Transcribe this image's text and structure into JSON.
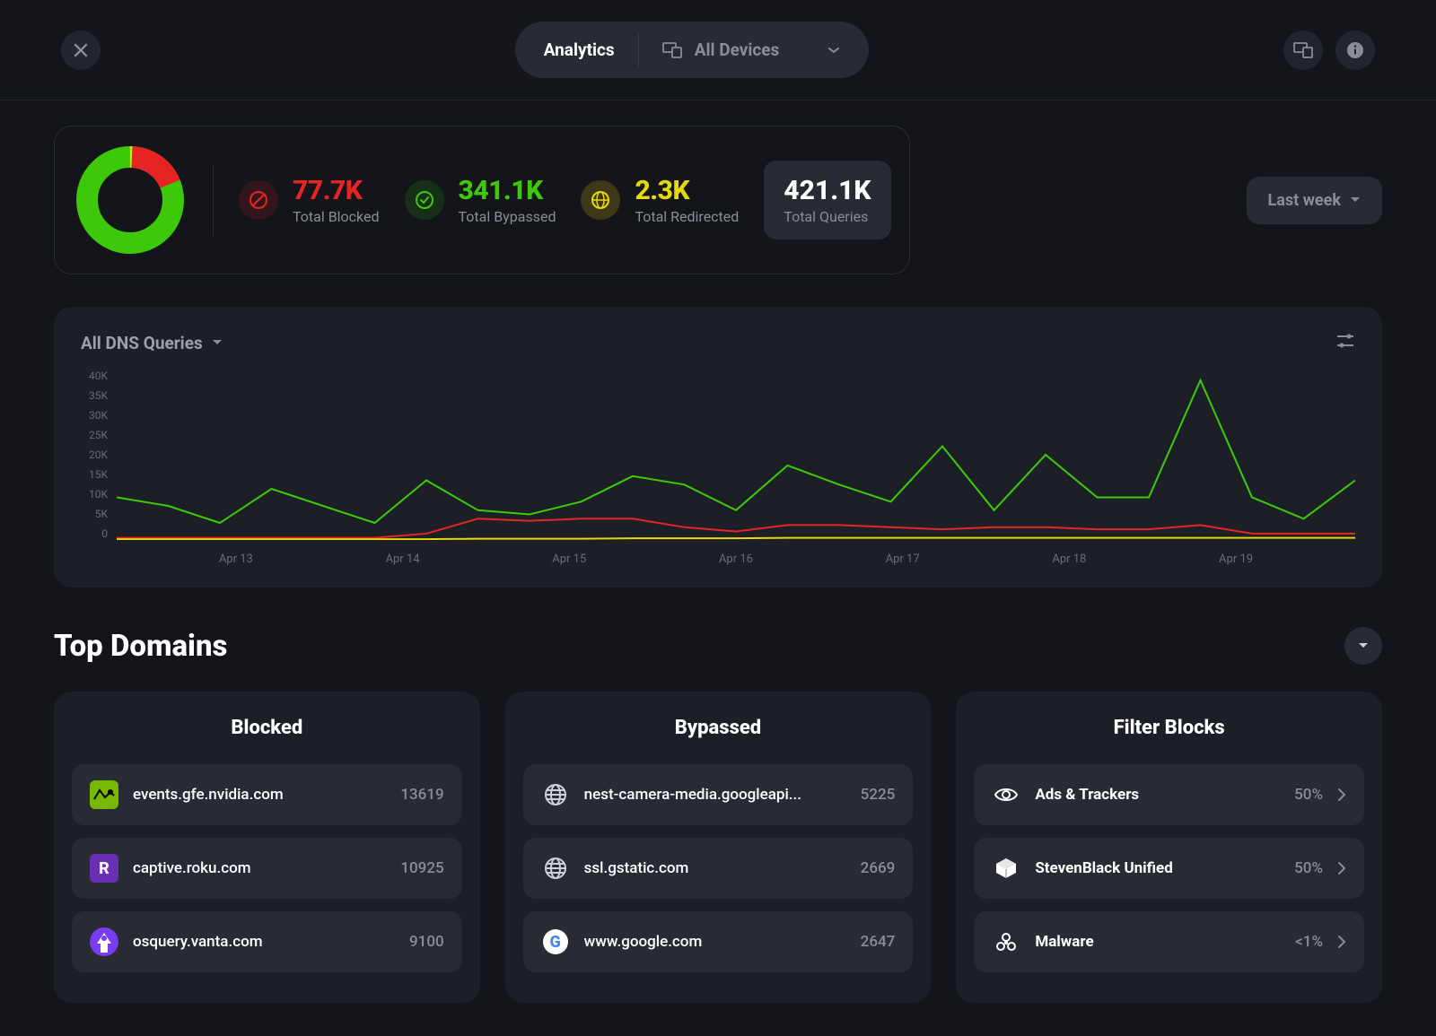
{
  "header": {
    "title": "Analytics",
    "device_selector": "All Devices"
  },
  "stats": {
    "blocked": {
      "value": "77.7K",
      "label": "Total Blocked"
    },
    "bypassed": {
      "value": "341.1K",
      "label": "Total Bypassed"
    },
    "redirected": {
      "value": "2.3K",
      "label": "Total Redirected"
    },
    "total": {
      "value": "421.1K",
      "label": "Total Queries"
    }
  },
  "range_selector": "Last week",
  "chart_selector": "All DNS Queries",
  "chart_data": {
    "type": "line",
    "title": "All DNS Queries",
    "ylabel": "",
    "xlabel": "",
    "ylim": [
      0,
      40000
    ],
    "y_ticks": [
      "40K",
      "35K",
      "30K",
      "25K",
      "20K",
      "15K",
      "10K",
      "5K",
      "0"
    ],
    "categories": [
      "Apr 13",
      "Apr 14",
      "Apr 15",
      "Apr 16",
      "Apr 17",
      "Apr 18",
      "Apr 19"
    ],
    "series": [
      {
        "name": "Bypassed",
        "color": "#3ec80a",
        "values": [
          10000,
          8000,
          4000,
          12000,
          8000,
          4000,
          14000,
          7000,
          6000,
          9000,
          15000,
          13000,
          7000,
          17500,
          13000,
          9000,
          22000,
          7000,
          20000,
          10000,
          10000,
          37500,
          10000,
          5000,
          14000
        ]
      },
      {
        "name": "Blocked",
        "color": "#e62424",
        "values": [
          500,
          500,
          500,
          500,
          500,
          500,
          1500,
          5000,
          4500,
          5000,
          5000,
          3000,
          2000,
          3500,
          3500,
          3000,
          2500,
          3000,
          3000,
          2500,
          2500,
          3500,
          1500,
          1500,
          1500
        ]
      },
      {
        "name": "Redirected",
        "color": "#e6d90a",
        "values": [
          200,
          200,
          200,
          200,
          200,
          200,
          200,
          300,
          300,
          300,
          400,
          400,
          400,
          500,
          500,
          500,
          500,
          500,
          500,
          500,
          500,
          500,
          500,
          500,
          500
        ]
      }
    ]
  },
  "top_domains_title": "Top Domains",
  "blocked_card": {
    "title": "Blocked",
    "rows": [
      {
        "icon_bg": "#76b900",
        "icon_text": "",
        "name": "events.gfe.nvidia.com",
        "count": "13619"
      },
      {
        "icon_bg": "#6b2fb3",
        "icon_text": "R",
        "name": "captive.roku.com",
        "count": "10925"
      },
      {
        "icon_bg": "#7a3cf0",
        "icon_text": "",
        "name": "osquery.vanta.com",
        "count": "9100"
      }
    ]
  },
  "bypassed_card": {
    "title": "Bypassed",
    "rows": [
      {
        "icon_type": "globe",
        "name": "nest-camera-media.googleapi...",
        "count": "5225"
      },
      {
        "icon_type": "globe",
        "name": "ssl.gstatic.com",
        "count": "2669"
      },
      {
        "icon_type": "google",
        "name": "www.google.com",
        "count": "2647"
      }
    ]
  },
  "filter_card": {
    "title": "Filter Blocks",
    "rows": [
      {
        "icon_type": "eye",
        "name": "Ads & Trackers",
        "count": "50%"
      },
      {
        "icon_type": "cube",
        "name": "StevenBlack Unified",
        "count": "50%"
      },
      {
        "icon_type": "biohazard",
        "name": "Malware",
        "count": "<1%"
      }
    ]
  }
}
